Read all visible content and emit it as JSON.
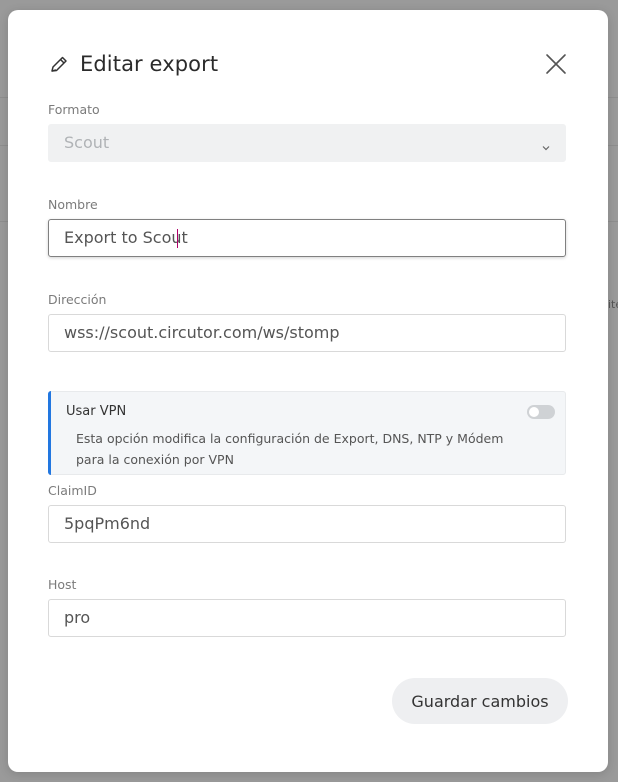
{
  "modal": {
    "title": "Editar export",
    "title_icon": "pencil-icon",
    "close_icon": "close-icon"
  },
  "form": {
    "formato": {
      "label": "Formato",
      "value": "Scout",
      "icon": "chevron-down-icon"
    },
    "nombre": {
      "label": "Nombre",
      "value": "Export to Scout"
    },
    "direccion": {
      "label": "Dirección",
      "value": "wss://scout.circutor.com/ws/stomp"
    },
    "vpn": {
      "title": "Usar VPN",
      "description": "Esta opción modifica la configuración de Export, DNS, NTP y Módem para la conexión por VPN",
      "enabled": false,
      "accent_color": "#2277e0"
    },
    "claim_id": {
      "label": "ClaimID",
      "value": "5pqPm6nd"
    },
    "host": {
      "label": "Host",
      "value": "pro"
    }
  },
  "actions": {
    "save_label": "Guardar cambios"
  },
  "background": {
    "partial_text": "ite"
  }
}
